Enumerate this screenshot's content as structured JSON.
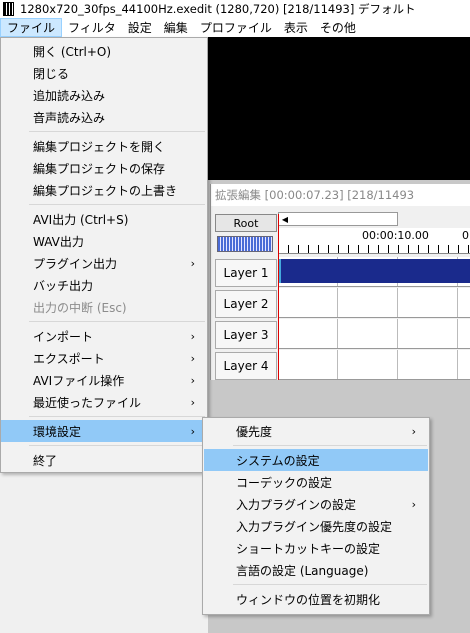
{
  "titlebar": {
    "title": "1280x720_30fps_44100Hz.exedit (1280,720)  [218/11493]  デフォルト",
    "icon": "film-strip-icon"
  },
  "menubar": {
    "items": [
      "ファイル",
      "フィルタ",
      "設定",
      "編集",
      "プロファイル",
      "表示",
      "その他"
    ]
  },
  "timeline": {
    "title": "拡張編集 [00:00:07.23] [218/11493",
    "root_label": "Root",
    "ruler_label": "00:00:10.00",
    "ruler_label2": "0",
    "layers": [
      "Layer 1",
      "Layer 2",
      "Layer 3",
      "Layer 4"
    ],
    "clip_color": "#1a2a8c"
  },
  "file_menu": {
    "items": [
      {
        "label": "開く (Ctrl+O)"
      },
      {
        "label": "閉じる"
      },
      {
        "label": "追加読み込み"
      },
      {
        "label": "音声読み込み"
      },
      {
        "label": "編集プロジェクトを開く"
      },
      {
        "label": "編集プロジェクトの保存"
      },
      {
        "label": "編集プロジェクトの上書き"
      },
      {
        "label": "AVI出力 (Ctrl+S)"
      },
      {
        "label": "WAV出力"
      },
      {
        "label": "プラグイン出力"
      },
      {
        "label": "バッチ出力"
      },
      {
        "label": "出力の中断 (Esc)"
      },
      {
        "label": "インポート"
      },
      {
        "label": "エクスポート"
      },
      {
        "label": "AVIファイル操作"
      },
      {
        "label": "最近使ったファイル"
      },
      {
        "label": "環境設定"
      },
      {
        "label": "終了"
      }
    ],
    "submenu_arrow": "›"
  },
  "settings_submenu": {
    "items": [
      {
        "label": "優先度"
      },
      {
        "label": "システムの設定"
      },
      {
        "label": "コーデックの設定"
      },
      {
        "label": "入力プラグインの設定"
      },
      {
        "label": "入力プラグイン優先度の設定"
      },
      {
        "label": "ショートカットキーの設定"
      },
      {
        "label": "言語の設定 (Language)"
      },
      {
        "label": "ウィンドウの位置を初期化"
      }
    ]
  },
  "colors": {
    "highlight": "#91c9f7",
    "menubar_active": "#cce8ff"
  }
}
